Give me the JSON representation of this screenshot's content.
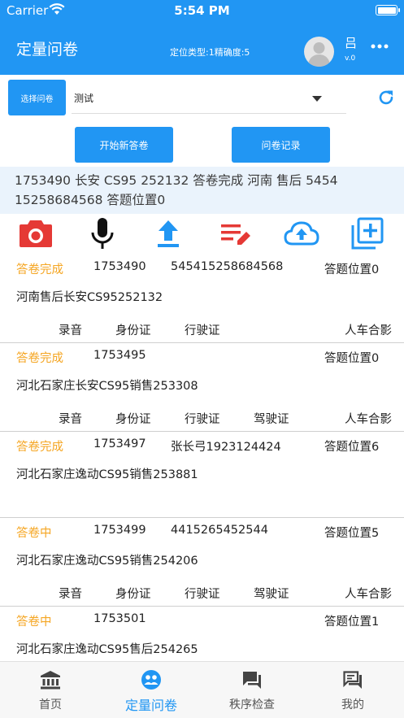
{
  "status_bar": {
    "carrier": "Carrier",
    "time": "5:54 PM"
  },
  "header": {
    "title": "定量问卷",
    "location_info": "定位类型:1精确度:5",
    "user_name": "吕",
    "version": "v.0",
    "more_icon": "more-dots-icon"
  },
  "selector": {
    "button_label": "选择问卷",
    "selected_value": "测试",
    "refresh_icon": "refresh-icon"
  },
  "actions": {
    "new_answer_label": "开始新答卷",
    "records_label": "问卷记录"
  },
  "info_text": "1753490 长安 CS95  252132 答卷完成 河南 售后 5454 15258684568 答题位置0",
  "toolbar": [
    {
      "icon": "camera-icon",
      "color": "#e53935"
    },
    {
      "icon": "microphone-icon",
      "color": "#111111"
    },
    {
      "icon": "upload-icon",
      "color": "#2196F3"
    },
    {
      "icon": "edit-list-icon",
      "color": "#e53935"
    },
    {
      "icon": "cloud-upload-icon",
      "color": "#2196F3"
    },
    {
      "icon": "add-box-icon",
      "color": "#2196F3"
    }
  ],
  "records": [
    {
      "status": "答卷完成",
      "id": "1753490",
      "phone": "545415258684568",
      "position": "答题位置0",
      "name": "河南售后长安CS95252132",
      "attachments": [
        "录音",
        "身份证",
        "行驶证",
        "",
        "人车合影"
      ]
    },
    {
      "status": "答卷完成",
      "id": "1753495",
      "phone": "",
      "position": "答题位置0",
      "name": "河北石家庄长安CS95销售253308",
      "attachments": [
        "录音",
        "身份证",
        "行驶证",
        "驾驶证",
        "人车合影"
      ]
    },
    {
      "status": "答卷完成",
      "id": "1753497",
      "phone": "张长弓1923124424",
      "position": "答题位置6",
      "name": "河北石家庄逸动CS95销售253881",
      "attachments": []
    },
    {
      "status": "答卷中",
      "id": "1753499",
      "phone": "4415265452544",
      "position": "答题位置5",
      "name": "河北石家庄逸动CS95销售254206",
      "attachments": [
        "录音",
        "身份证",
        "行驶证",
        "驾驶证",
        "人车合影"
      ]
    },
    {
      "status": "答卷中",
      "id": "1753501",
      "phone": "",
      "position": "答题位置1",
      "name": "河北石家庄逸动CS95售后254265",
      "attachments": []
    }
  ],
  "tabbar": [
    {
      "label": "首页",
      "icon": "bank-icon"
    },
    {
      "label": "定量问卷",
      "icon": "survey-icon"
    },
    {
      "label": "秩序检查",
      "icon": "chat-icon"
    },
    {
      "label": "我的",
      "icon": "chat-outline-icon"
    }
  ],
  "colors": {
    "primary": "#2196F3",
    "status_orange": "#f5a623"
  }
}
